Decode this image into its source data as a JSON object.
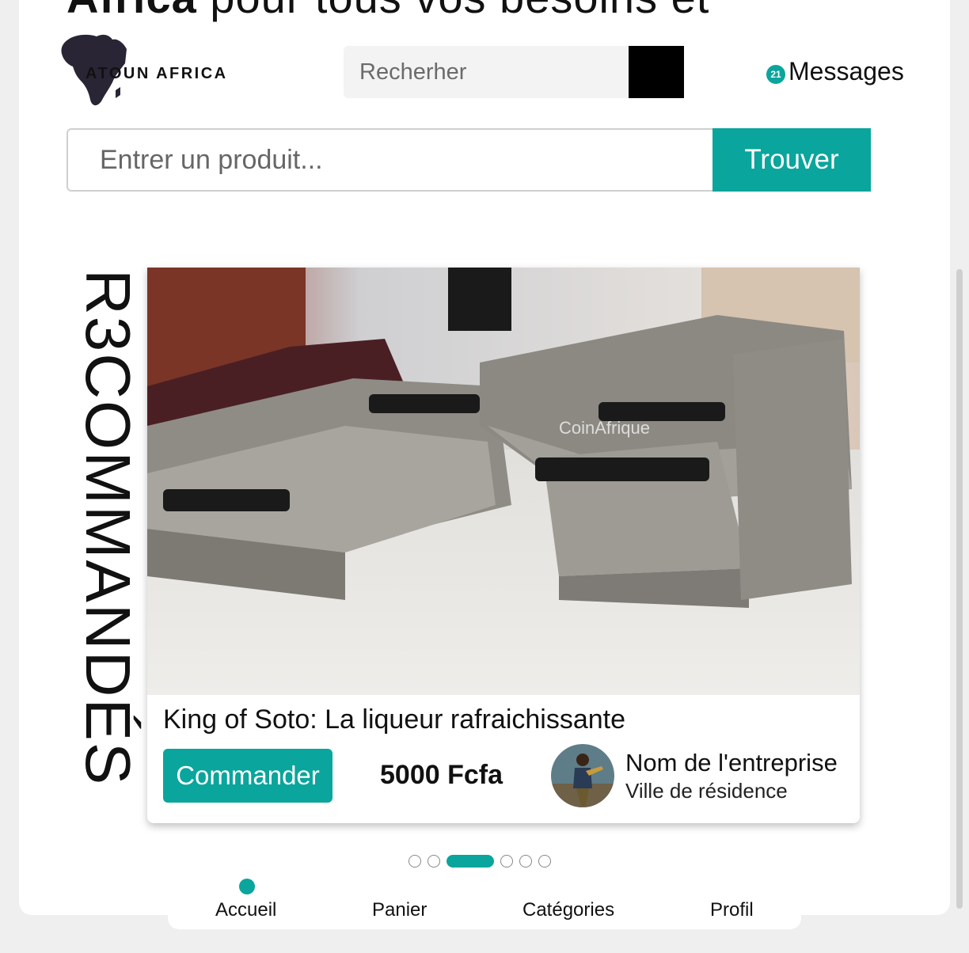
{
  "hero": {
    "bold": "Africa",
    "rest": " pour tous vos besoins et"
  },
  "brand": {
    "name": "ATOUN AFRICA"
  },
  "search": {
    "placeholder": "Recherher"
  },
  "messages": {
    "count": "21",
    "label": "Messages"
  },
  "product_search": {
    "placeholder": "Entrer un produit...",
    "button": "Trouver"
  },
  "section": {
    "title": "R3COMMANDÉS"
  },
  "card": {
    "image_watermark": "CoinAfrique",
    "title": "King of Soto: La liqueur rafraichissante",
    "order_button": "Commander",
    "price": "5000 Fcfa",
    "seller_name": "Nom de l'entreprise",
    "seller_city": "Ville de résidence"
  },
  "carousel": {
    "count": 6,
    "active": 2
  },
  "nav": {
    "items": [
      "Accueil",
      "Panier",
      "Catégories",
      "Profil"
    ]
  },
  "colors": {
    "accent": "#0aa59c",
    "text": "#111111",
    "black": "#000000"
  },
  "icons": {
    "search_button": "search-icon",
    "badge": "notification-badge"
  }
}
